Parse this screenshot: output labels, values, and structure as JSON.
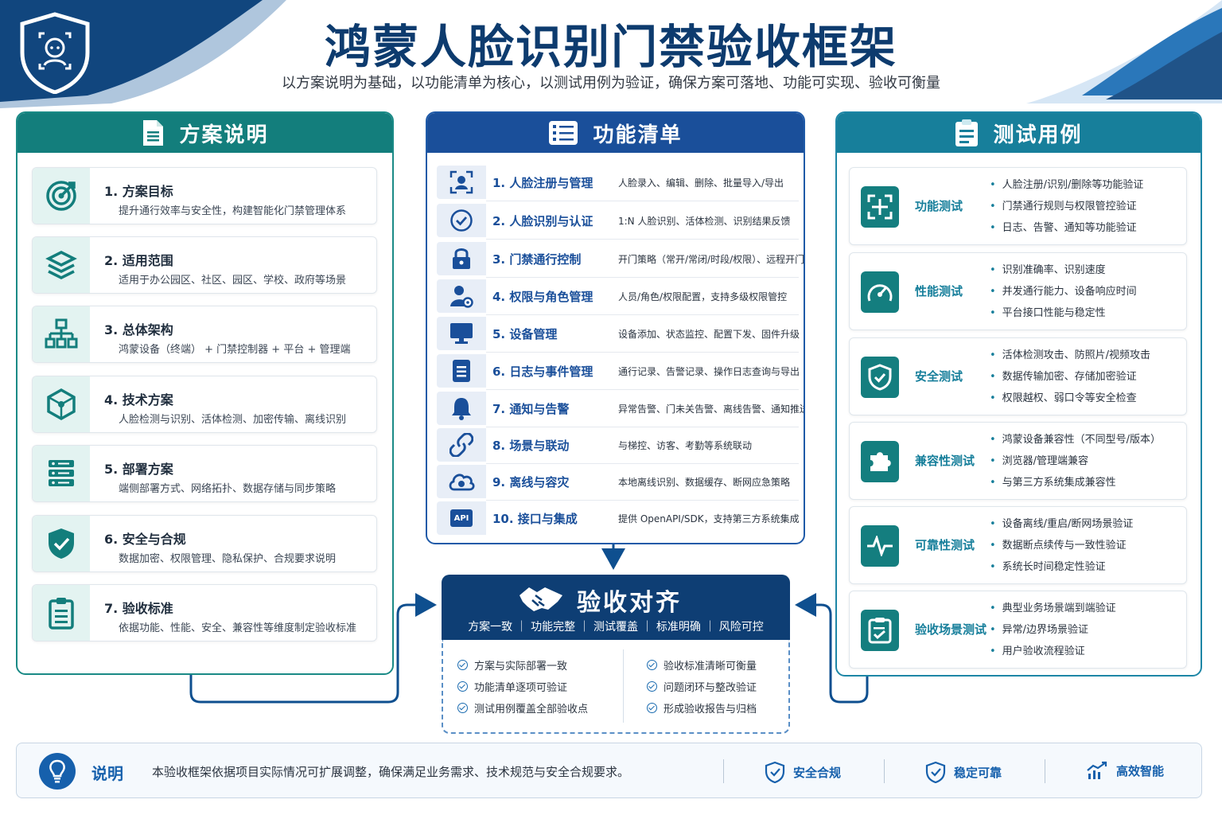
{
  "header": {
    "title": "鸿蒙人脸识别门禁验收框架",
    "subtitle": "以方案说明为基础，以功能清单为核心，以测试用例为验证，确保方案可落地、功能可实现、验收可衡量"
  },
  "colors": {
    "navy": "#0d3b6e",
    "teal": "#137e7c",
    "blue": "#1a4f9a",
    "cyan": "#177f9b",
    "accent": "#1660ac"
  },
  "scheme": {
    "title": "方案说明",
    "icon": "document-icon",
    "items": [
      {
        "title": "1. 方案目标",
        "desc": "提升通行效率与安全性，构建智能化门禁管理体系",
        "icon": "target-icon"
      },
      {
        "title": "2. 适用范围",
        "desc": "适用于办公园区、社区、园区、学校、政府等场景",
        "icon": "layers-icon"
      },
      {
        "title": "3. 总体架构",
        "desc": "鸿蒙设备（终端） + 门禁控制器 + 平台 + 管理端",
        "icon": "org-chart-icon"
      },
      {
        "title": "4. 技术方案",
        "desc": "人脸检测与识别、活体检测、加密传输、离线识别",
        "icon": "cube-icon"
      },
      {
        "title": "5. 部署方案",
        "desc": "端侧部署方式、网络拓扑、数据存储与同步策略",
        "icon": "server-icon"
      },
      {
        "title": "6. 安全与合规",
        "desc": "数据加密、权限管理、隐私保护、合规要求说明",
        "icon": "shield-check-icon"
      },
      {
        "title": "7. 验收标准",
        "desc": "依据功能、性能、安全、兼容性等维度制定验收标准",
        "icon": "clipboard-icon"
      }
    ]
  },
  "features": {
    "title": "功能清单",
    "icon": "list-icon",
    "items": [
      {
        "title": "1. 人脸注册与管理",
        "desc": "人脸录入、编辑、删除、批量导入/导出",
        "icon": "face-scan-icon"
      },
      {
        "title": "2. 人脸识别与认证",
        "desc": "1:N 人脸识别、活体检测、识别结果反馈",
        "icon": "check-circle-icon"
      },
      {
        "title": "3. 门禁通行控制",
        "desc": "开门策略（常开/常闭/时段/权限）、远程开门",
        "icon": "lock-icon"
      },
      {
        "title": "4. 权限与角色管理",
        "desc": "人员/角色/权限配置，支持多级权限管控",
        "icon": "user-gear-icon"
      },
      {
        "title": "5. 设备管理",
        "desc": "设备添加、状态监控、配置下发、固件升级",
        "icon": "monitor-icon"
      },
      {
        "title": "6. 日志与事件管理",
        "desc": "通行记录、告警记录、操作日志查询与导出",
        "icon": "file-icon"
      },
      {
        "title": "7. 通知与告警",
        "desc": "异常告警、门未关告警、离线告警、通知推送",
        "icon": "bell-icon"
      },
      {
        "title": "8. 场景与联动",
        "desc": "与梯控、访客、考勤等系统联动",
        "icon": "link-icon"
      },
      {
        "title": "9. 离线与容灾",
        "desc": "本地离线识别、数据缓存、断网应急策略",
        "icon": "cloud-icon"
      },
      {
        "title": "10. 接口与集成",
        "desc": "提供 OpenAPI/SDK，支持第三方系统集成",
        "icon": "api-icon",
        "badge": "API"
      }
    ]
  },
  "tests": {
    "title": "测试用例",
    "icon": "clipboard-list-icon",
    "items": [
      {
        "label": "功能测试",
        "icon": "grid-icon",
        "points": [
          "人脸注册/识别/删除等功能验证",
          "门禁通行规则与权限管控验证",
          "日志、告警、通知等功能验证"
        ]
      },
      {
        "label": "性能测试",
        "icon": "speedometer-icon",
        "points": [
          "识别准确率、识别速度",
          "并发通行能力、设备响应时间",
          "平台接口性能与稳定性"
        ]
      },
      {
        "label": "安全测试",
        "icon": "shield-icon",
        "points": [
          "活体检测攻击、防照片/视频攻击",
          "数据传输加密、存储加密验证",
          "权限越权、弱口令等安全检查"
        ]
      },
      {
        "label": "兼容性测试",
        "icon": "puzzle-icon",
        "points": [
          "鸿蒙设备兼容性（不同型号/版本）",
          "浏览器/管理端兼容",
          "与第三方系统集成兼容性"
        ]
      },
      {
        "label": "可靠性测试",
        "icon": "pulse-icon",
        "points": [
          "设备离线/重启/断网场景验证",
          "数据断点续传与一致性验证",
          "系统长时间稳定性验证"
        ]
      },
      {
        "label": "验收场景测试",
        "icon": "checklist-icon",
        "points": [
          "典型业务场景端到端验证",
          "异常/边界场景验证",
          "用户验收流程验证"
        ]
      }
    ]
  },
  "alignment": {
    "title": "验收对齐",
    "icon": "handshake-icon",
    "subtitle": "方案一致 ｜ 功能完整 ｜ 测试覆盖 ｜ 标准明确 ｜ 风险可控",
    "left": [
      "方案与实际部署一致",
      "功能清单逐项可验证",
      "测试用例覆盖全部验收点"
    ],
    "right": [
      "验收标准清晰可衡量",
      "问题闭环与整改验证",
      "形成验收报告与归档"
    ]
  },
  "footer": {
    "label": "说明",
    "text": "本验收框架依据项目实际情况可扩展调整，确保满足业务需求、技术规范与安全合规要求。",
    "badges": [
      {
        "label": "安全合规",
        "icon": "shield-check-icon"
      },
      {
        "label": "稳定可靠",
        "icon": "shield-check-icon"
      },
      {
        "label": "高效智能",
        "icon": "trend-chart-icon"
      }
    ]
  }
}
